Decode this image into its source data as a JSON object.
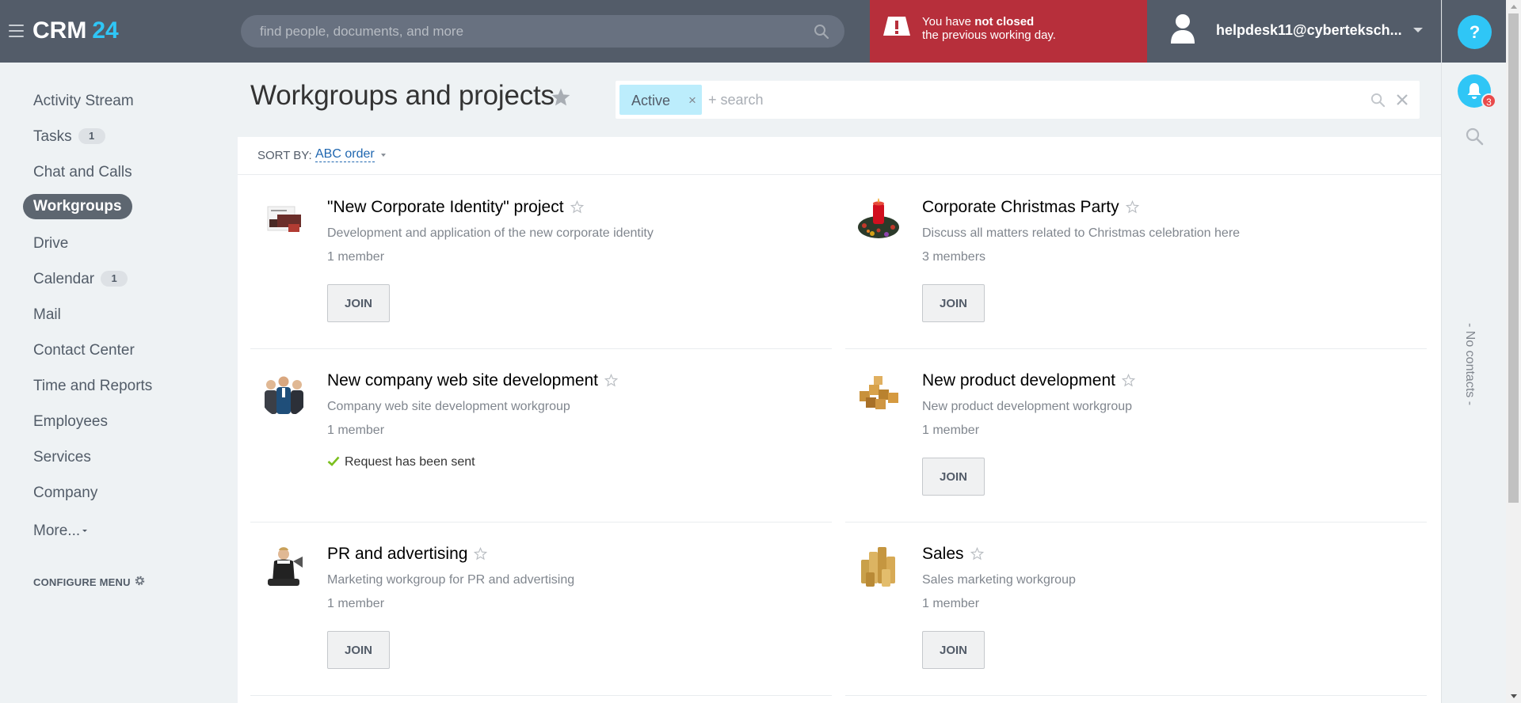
{
  "header": {
    "logo_text": "CRM",
    "logo_number": "24",
    "search_placeholder": "find people, documents, and more",
    "warning_line1_prefix": "You have ",
    "warning_line1_bold": "not closed",
    "warning_line2": "the previous working day.",
    "user_name": "helpdesk11@cyberteksch..."
  },
  "right_rail": {
    "help_label": "?",
    "notifications_count": "3",
    "no_contacts": "- No contacts -"
  },
  "sidebar": {
    "items": [
      {
        "label": "Activity Stream"
      },
      {
        "label": "Tasks",
        "count": "1"
      },
      {
        "label": "Chat and Calls"
      },
      {
        "label": "Workgroups",
        "active": true
      },
      {
        "label": "Drive"
      },
      {
        "label": "Calendar",
        "count": "1"
      },
      {
        "label": "Mail"
      },
      {
        "label": "Contact Center"
      },
      {
        "label": "Time and Reports"
      },
      {
        "label": "Employees"
      },
      {
        "label": "Services"
      },
      {
        "label": "Company"
      }
    ],
    "more_label": "More...",
    "configure_label": "CONFIGURE MENU"
  },
  "page": {
    "title": "Workgroups and projects",
    "filter_chip": "Active",
    "filter_chip_remove": "×",
    "filter_placeholder": "+ search"
  },
  "sort": {
    "label": "SORT BY:",
    "value": "ABC order"
  },
  "groups": [
    {
      "name": "\"New Corporate Identity\" project",
      "description": "Development and application of the new corporate identity",
      "members": "1 member",
      "action": "JOIN",
      "image_icon": "corporate-identity-brochure"
    },
    {
      "name": "Corporate Christmas Party",
      "description": "Discuss all matters related to Christmas celebration here",
      "members": "3 members",
      "action": "JOIN",
      "image_icon": "christmas-wreath-candle"
    },
    {
      "name": "New company web site development",
      "description": "Company web site development workgroup",
      "members": "1 member",
      "request": "Request has been sent",
      "image_icon": "three-people"
    },
    {
      "name": "New product development",
      "description": "New product development workgroup",
      "members": "1 member",
      "action": "JOIN",
      "image_icon": "wooden-blocks"
    },
    {
      "name": "PR and advertising",
      "description": "Marketing workgroup for PR and advertising",
      "members": "1 member",
      "action": "JOIN",
      "image_icon": "person-with-megaphone"
    },
    {
      "name": "Sales",
      "description": "Sales marketing workgroup",
      "members": "1 member",
      "action": "JOIN",
      "image_icon": "stacked-coins"
    }
  ],
  "colors": {
    "topbar": "#535c69",
    "accent": "#2fc6f6",
    "warning": "#b72f3b",
    "link": "#2067b0",
    "chip": "#bcedfc"
  }
}
